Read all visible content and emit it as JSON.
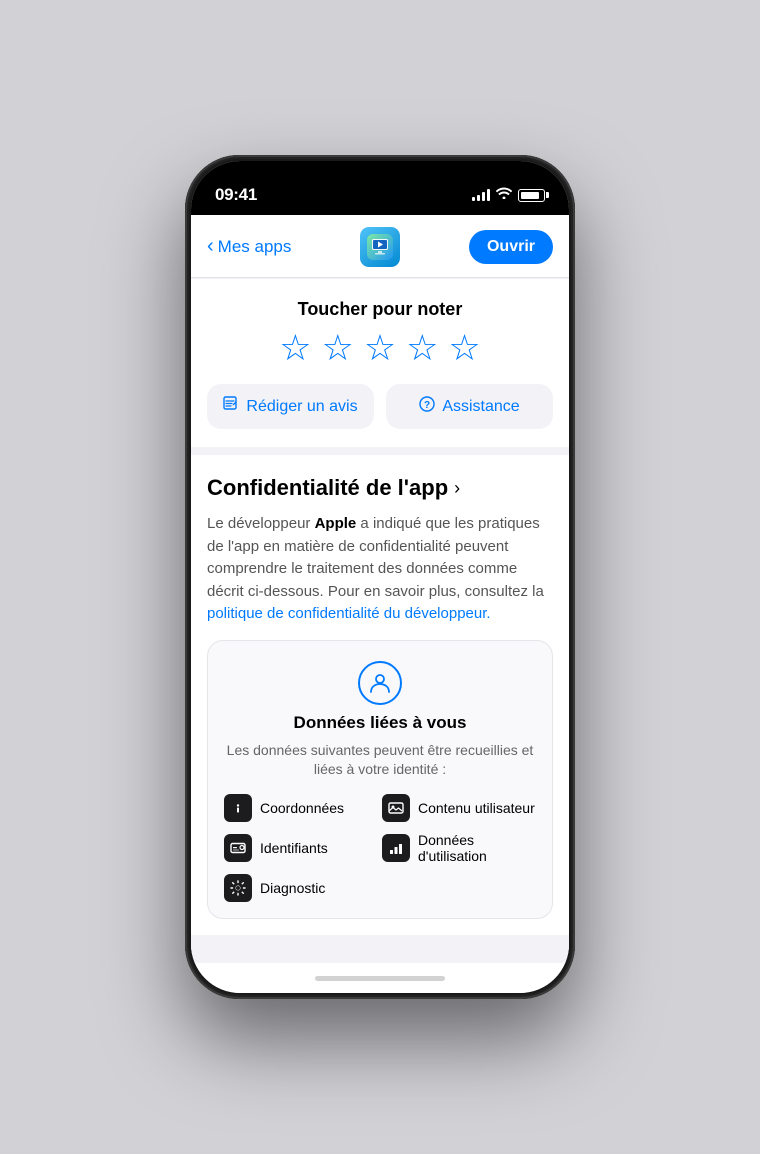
{
  "status_bar": {
    "time": "09:41"
  },
  "nav": {
    "back_label": "Mes apps",
    "open_button": "Ouvrir"
  },
  "rating": {
    "title": "Toucher pour noter",
    "stars": [
      "☆",
      "☆",
      "☆",
      "☆",
      "☆"
    ]
  },
  "actions": {
    "review_icon": "✏",
    "review_label": "Rédiger un avis",
    "assistance_icon": "?",
    "assistance_label": "Assistance"
  },
  "privacy": {
    "title": "Confidentialité de l'app",
    "chevron": "›",
    "description_prefix": "Le développeur ",
    "description_bold": "Apple",
    "description_suffix": " a indiqué que les pratiques de l'app en matière de confidentialité peuvent comprendre le traitement des données comme décrit ci-dessous. Pour en savoir plus, consultez la ",
    "link_text": "politique de confidentialité du développeur.",
    "card": {
      "title": "Données liées à vous",
      "subtitle": "Les données suivantes peuvent être recueillies\net liées à votre identité :",
      "items": [
        {
          "id": "coordonnees",
          "label": "Coordonnées",
          "icon": "info"
        },
        {
          "id": "contenu",
          "label": "Contenu utilisateur",
          "icon": "photo"
        },
        {
          "id": "identifiants",
          "label": "Identifiants",
          "icon": "card"
        },
        {
          "id": "donnees-utilisation",
          "label": "Données\nd'utilisation",
          "icon": "chart"
        },
        {
          "id": "diagnostic",
          "label": "Diagnostic",
          "icon": "gear"
        }
      ]
    }
  }
}
